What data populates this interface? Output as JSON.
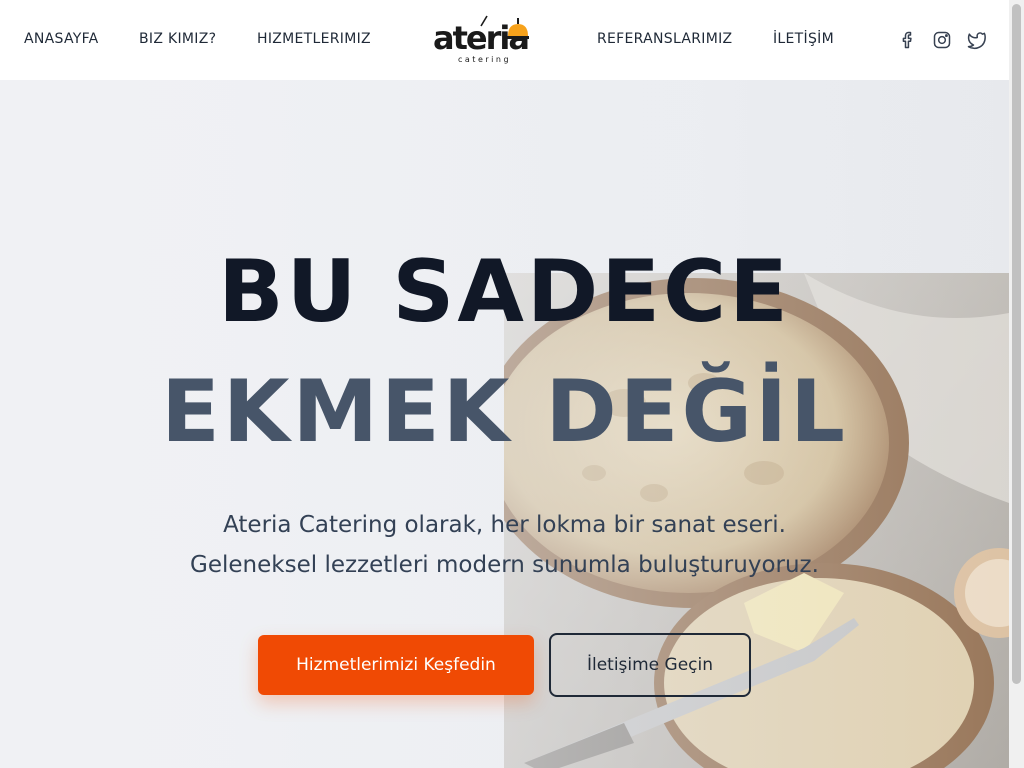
{
  "nav": {
    "left": [
      "ANASAYFA",
      "BIZ KIMIZ?",
      "HIZMETLERIMIZ"
    ],
    "right": [
      "REFERANSLARIMIZ",
      "İLETİŞİM"
    ]
  },
  "logo": {
    "word": "ateria",
    "sub": "catering"
  },
  "social": {
    "icons": [
      "facebook-icon",
      "instagram-icon",
      "twitter-icon"
    ]
  },
  "hero": {
    "headline_line1": "BU SADECE",
    "headline_line2": "EKMEK DEĞİL",
    "subtitle_line1": "Ateria Catering olarak, her lokma bir sanat eseri.",
    "subtitle_line2": "Geleneksel lezzetleri modern sunumla buluşturuyoruz.",
    "primary_button": "Hizmetlerimizi Keşfedin",
    "secondary_button": "İletişime Geçin"
  },
  "colors": {
    "accent": "#f04a04",
    "headline_dark": "#111827",
    "headline_slate": "#475569"
  }
}
